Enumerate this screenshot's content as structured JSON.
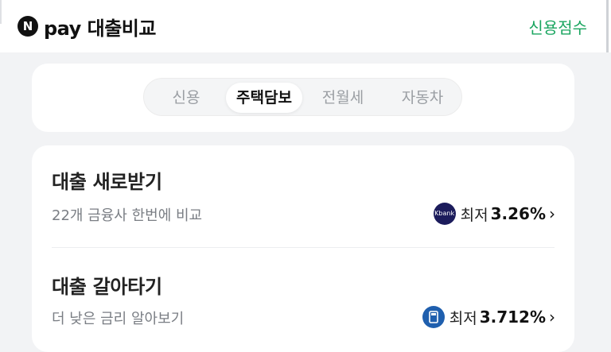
{
  "header": {
    "logo_letter": "N",
    "brand": "pay 대출비교",
    "credit_score_link": "신용점수"
  },
  "tabs": [
    {
      "label": "신용",
      "active": false
    },
    {
      "label": "주택담보",
      "active": true
    },
    {
      "label": "전월세",
      "active": false
    },
    {
      "label": "자동차",
      "active": false
    }
  ],
  "items": [
    {
      "title": "대출 새로받기",
      "subtitle": "22개 금융사 한번에 비교",
      "bank_logo_text": "Kbank",
      "bank_color": "#1c1c5c",
      "rate_label": "최저",
      "rate_value": "3.26%"
    },
    {
      "title": "대출 갈아타기",
      "subtitle": "더 낮은 금리 알아보기",
      "bank_logo_icon": "card-icon",
      "bank_color": "#1f5fae",
      "rate_label": "최저",
      "rate_value": "3.712%"
    }
  ],
  "colors": {
    "accent_green": "#19a55f",
    "background": "#f2f3f5"
  }
}
